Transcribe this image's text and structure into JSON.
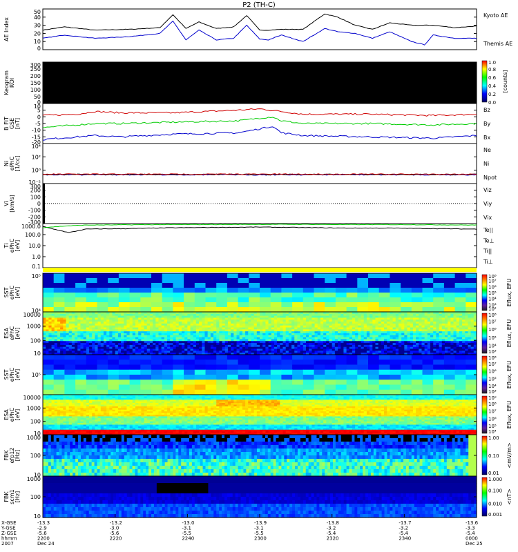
{
  "title": "P2 (TH-C)",
  "colors": {
    "blue": "#0000cc",
    "red": "#d00000",
    "green": "#00cc00",
    "black": "#000000",
    "yellow": "#ffff00"
  },
  "chart_data": [
    {
      "type": "line",
      "panel": "ae",
      "ylabel": "AE Index",
      "ylim": [
        0,
        50
      ],
      "ticks": [
        "50",
        "40",
        "30",
        "20",
        "10",
        "0"
      ],
      "series": [
        {
          "name": "Kyoto AE",
          "color": "#000000",
          "x": [
            0,
            0.05,
            0.12,
            0.2,
            0.27,
            0.3,
            0.33,
            0.36,
            0.4,
            0.44,
            0.47,
            0.5,
            0.52,
            0.55,
            0.6,
            0.65,
            0.68,
            0.72,
            0.76,
            0.8,
            0.85,
            0.9,
            0.95,
            1.0
          ],
          "values": [
            24,
            28,
            24,
            25,
            27,
            43,
            26,
            34,
            26,
            28,
            42,
            24,
            24,
            25,
            25,
            44,
            40,
            30,
            25,
            33,
            30,
            30,
            27,
            29
          ]
        },
        {
          "name": "Themis AE",
          "color": "#0000cc",
          "x": [
            0,
            0.05,
            0.12,
            0.2,
            0.27,
            0.3,
            0.33,
            0.36,
            0.4,
            0.44,
            0.47,
            0.5,
            0.52,
            0.55,
            0.6,
            0.65,
            0.68,
            0.72,
            0.76,
            0.8,
            0.85,
            0.88,
            0.9,
            0.95,
            1.0
          ],
          "values": [
            14,
            18,
            14,
            16,
            20,
            35,
            12,
            24,
            12,
            14,
            30,
            13,
            12,
            18,
            10,
            26,
            22,
            20,
            14,
            22,
            10,
            6,
            18,
            14,
            14
          ]
        }
      ]
    },
    {
      "type": "heatmap",
      "panel": "keogram",
      "ylabel": "Keogram",
      "ylabel2": "ROI",
      "ylim": [
        0,
        300
      ],
      "ticks": [
        "300",
        "250",
        "200",
        "150",
        "100",
        "50",
        "0"
      ],
      "colorbar": {
        "label": "[counts]",
        "ticks": [
          "1.0",
          "0.8",
          "0.6",
          "0.4",
          "0.2",
          "0.0"
        ]
      }
    },
    {
      "type": "line",
      "panel": "b",
      "ylabel": "B FIT",
      "ylabel2": "GSE",
      "unit": "[nT]",
      "ylim": [
        -20,
        10
      ],
      "ticks": [
        "10",
        "5",
        "0",
        "-5",
        "-10",
        "-15",
        "-20"
      ],
      "series": [
        {
          "name": "Bz",
          "color": "#d00000",
          "x": [
            0,
            0.08,
            0.12,
            0.18,
            0.3,
            0.45,
            0.5,
            0.55,
            0.6,
            0.75,
            0.9,
            1.0
          ],
          "values": [
            1,
            2,
            4,
            3,
            3,
            5,
            6,
            4,
            2,
            2,
            1,
            2
          ]
        },
        {
          "name": "By",
          "color": "#00cc00",
          "x": [
            0,
            0.08,
            0.12,
            0.18,
            0.3,
            0.45,
            0.5,
            0.53,
            0.55,
            0.6,
            0.75,
            0.9,
            1.0
          ],
          "values": [
            -8,
            -6,
            -5,
            -5,
            -4,
            -3,
            -1,
            0,
            -3,
            -5,
            -5,
            -6,
            -5
          ]
        },
        {
          "name": "Bx",
          "color": "#0000cc",
          "x": [
            0,
            0.08,
            0.12,
            0.18,
            0.3,
            0.45,
            0.5,
            0.53,
            0.55,
            0.6,
            0.75,
            0.9,
            1.0
          ],
          "values": [
            -17,
            -15,
            -14,
            -15,
            -13,
            -12,
            -9,
            -7,
            -12,
            -14,
            -15,
            -16,
            -14
          ]
        }
      ]
    },
    {
      "type": "line",
      "panel": "n",
      "ylabel": "Ni",
      "ylabel2": "ePhC",
      "unit": "[1/cc]",
      "ticks": [
        "10⁴",
        "10²",
        "10⁰",
        "10⁻²"
      ],
      "series": [
        {
          "name": "Ne",
          "color": "#d00000"
        },
        {
          "name": "Ni",
          "color": "#000000"
        },
        {
          "name": "Npot",
          "color": "#0000cc"
        }
      ]
    },
    {
      "type": "line",
      "panel": "v",
      "ylabel": "Vi",
      "unit": "[km/s]",
      "ylim": [
        -300,
        300
      ],
      "ticks": [
        "300",
        "200",
        "100",
        "0",
        "-100",
        "-200",
        "-300"
      ],
      "series": [
        {
          "name": "Viz",
          "color": "#d00000"
        },
        {
          "name": "Viy",
          "color": "#00cc00"
        },
        {
          "name": "Vix",
          "color": "#0000cc"
        }
      ]
    },
    {
      "type": "line",
      "panel": "t",
      "ylabel": "Ti",
      "ylabel2": "ePhC",
      "unit": "[eV]",
      "ticks": [
        "1000.0",
        "100.0",
        "10.0",
        "1.0",
        "0.1"
      ],
      "series": [
        {
          "name": "Te||",
          "color": "#000000",
          "x": [
            0,
            0.03,
            0.06,
            0.1,
            0.2,
            0.3,
            0.5,
            0.6,
            0.7,
            0.8,
            0.9,
            1.0
          ],
          "values": [
            3.0,
            2.7,
            2.4,
            2.75,
            2.8,
            2.88,
            2.95,
            2.9,
            2.85,
            2.85,
            2.8,
            2.75
          ]
        },
        {
          "name": "Te⊥",
          "color": "#d00000"
        },
        {
          "name": "Ti||",
          "color": "#00cc00",
          "x": [
            0,
            0.05,
            0.1,
            0.2,
            0.3,
            0.5,
            0.6,
            0.7,
            0.8,
            0.9,
            1.0
          ],
          "values": [
            2.9,
            3.05,
            3.15,
            3.18,
            3.2,
            3.22,
            3.22,
            3.2,
            3.2,
            3.18,
            3.15
          ]
        },
        {
          "name": "Ti⊥",
          "color": "#0000cc"
        }
      ]
    },
    {
      "type": "heatmap",
      "panel": "sst_i",
      "ylabel": "SST",
      "ylabel2": "ePhC",
      "unit": "[eV]",
      "ticks": [
        "10⁵",
        "10⁴"
      ],
      "colorbar": {
        "label": "Eflux, EFU",
        "ticks": [
          "10⁸",
          "10⁷",
          "10⁶",
          "10⁵",
          "10⁴",
          "10³",
          "10²"
        ]
      }
    },
    {
      "type": "heatmap",
      "panel": "esa_i",
      "ylabel": "ESA",
      "ylabel2": "ePhC",
      "unit": "[eV]",
      "ticks": [
        "10000",
        "1000",
        "100",
        "10"
      ],
      "colorbar": {
        "label": "Eflux, EFU",
        "ticks": [
          "10⁸",
          "10⁷",
          "10⁶",
          "10⁵",
          "10⁴",
          "10³"
        ]
      }
    },
    {
      "type": "heatmap",
      "panel": "sst_e",
      "ylabel": "SST",
      "ylabel2": "ePhC",
      "unit": "[eV]",
      "ticks": [
        "10⁵"
      ],
      "colorbar": {
        "label": "Eflux, EFU",
        "ticks": [
          "10⁸",
          "10⁷",
          "10⁶",
          "10⁵",
          "10⁴",
          "10³"
        ]
      }
    },
    {
      "type": "heatmap",
      "panel": "esa_e",
      "ylabel": "ESA",
      "ylabel2": "ePhC",
      "unit": "[eV]",
      "ticks": [
        "10000",
        "1000",
        "100",
        "10"
      ],
      "colorbar": {
        "label": "Eflux, EFU",
        "ticks": [
          "10⁹",
          "10⁸",
          "10⁷",
          "10⁶",
          "10⁵",
          "10⁴"
        ]
      }
    },
    {
      "type": "heatmap",
      "panel": "fbk_e",
      "ylabel": "FBK",
      "ylabel2": "efp12",
      "unit": "[Hz]",
      "ticks": [
        "1000",
        "100",
        "10"
      ],
      "colorbar": {
        "label": "<mV/m>",
        "ticks": [
          "1.00",
          "0.10",
          "0.01"
        ]
      }
    },
    {
      "type": "heatmap",
      "panel": "fbk_b",
      "ylabel": "FBK",
      "ylabel2": "scm1",
      "unit": "[Hz]",
      "ticks": [
        "1000",
        "100",
        "10"
      ],
      "colorbar": {
        "label": "<nT>",
        "ticks": [
          "1.000",
          "0.100",
          "0.010",
          "0.001"
        ]
      }
    }
  ],
  "time_axis": {
    "row_labels": [
      "X-GSE",
      "Y-GSE",
      "Z-GSE",
      "hhmm",
      "2007"
    ],
    "columns": [
      {
        "x": "-13.3",
        "y": "-2.9",
        "z": "-5.6",
        "hhmm": "2200",
        "date": "Dec 24"
      },
      {
        "x": "-13.2",
        "y": "-3.0",
        "z": "-5.6",
        "hhmm": "2220",
        "date": ""
      },
      {
        "x": "-13.0",
        "y": "-3.1",
        "z": "-5.5",
        "hhmm": "2240",
        "date": ""
      },
      {
        "x": "-13.9",
        "y": "-3.1",
        "z": "-5.5",
        "hhmm": "2300",
        "date": ""
      },
      {
        "x": "-13.8",
        "y": "-3.2",
        "z": "-5.4",
        "hhmm": "2320",
        "date": ""
      },
      {
        "x": "-13.7",
        "y": "-3.2",
        "z": "-5.4",
        "hhmm": "2340",
        "date": ""
      },
      {
        "x": "-13.6",
        "y": "-3.3",
        "z": "-5.4",
        "hhmm": "0000",
        "date": "Dec 25"
      }
    ]
  }
}
